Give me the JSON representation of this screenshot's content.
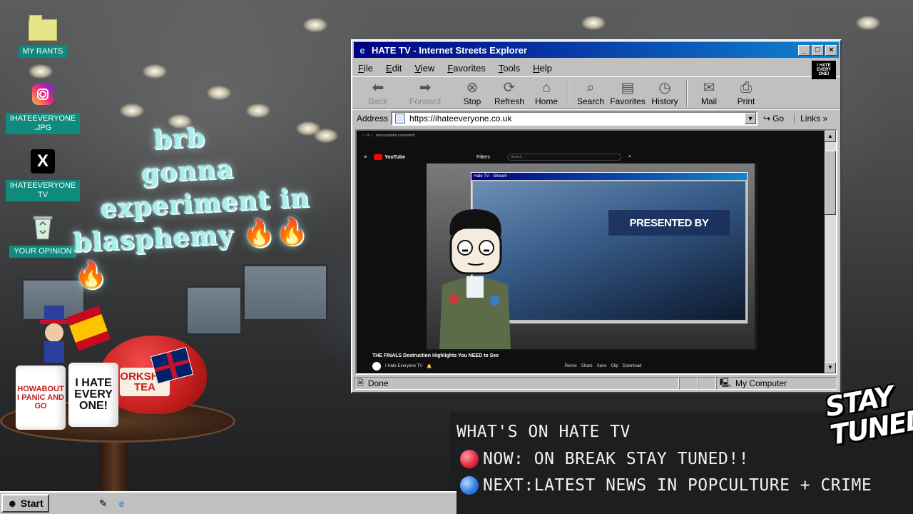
{
  "desktop": {
    "icons": [
      {
        "label": "MY RANTS",
        "icon": "folder-icon"
      },
      {
        "label": "IHATEEVERYONE\n.JPG",
        "icon": "instagram-icon"
      },
      {
        "label": "IHATEEVERYONE\nTV",
        "icon": "x-icon"
      },
      {
        "label": "YOUR OPINION",
        "icon": "recycle-bin-icon"
      }
    ],
    "brb_lines": [
      "brb",
      "gonna",
      "experiment in",
      "blasphemy 🔥🔥🔥"
    ]
  },
  "browser": {
    "title": "HATE TV - Internet Streets Explorer",
    "menu": [
      "File",
      "Edit",
      "View",
      "Favorites",
      "Tools",
      "Help"
    ],
    "brand_badge": "I HATE EVERY ONE!",
    "toolbar": [
      {
        "label": "Back",
        "icon": "back-arrow-icon",
        "enabled": false
      },
      {
        "label": "Forward",
        "icon": "forward-arrow-icon",
        "enabled": false
      },
      {
        "label": "Stop",
        "icon": "stop-icon",
        "enabled": true
      },
      {
        "label": "Refresh",
        "icon": "refresh-icon",
        "enabled": true
      },
      {
        "label": "Home",
        "icon": "home-icon",
        "enabled": true
      },
      {
        "label": "Search",
        "icon": "search-icon",
        "enabled": true
      },
      {
        "label": "Favorites",
        "icon": "favorites-icon",
        "enabled": true
      },
      {
        "label": "History",
        "icon": "history-icon",
        "enabled": true
      },
      {
        "label": "Mail",
        "icon": "mail-icon",
        "enabled": true
      },
      {
        "label": "Print",
        "icon": "print-icon",
        "enabled": true
      }
    ],
    "address_label": "Address",
    "address_value": "https://ihateeveryone.co.uk",
    "go_label": "Go",
    "links_label": "Links",
    "status_text": "Done",
    "zone_text": "My Computer"
  },
  "youtube": {
    "logo": "YouTube",
    "search_placeholder": "Search",
    "filters_label": "Filters",
    "stream_window_title": "Hate TV - Stream",
    "presented_by": "PRESENTED BY",
    "video_title": "THE FINALS Destruction Highlights You NEED to See",
    "channel_name": "I Hate Everyone TV",
    "actions": [
      "Remix",
      "Share",
      "Save",
      "Clip",
      "Download"
    ]
  },
  "ticker": {
    "heading": "WHAT'S ON HATE TV",
    "now": "NOW: ON BREAK STAY TUNED!!",
    "next": "NEXT:LATEST NEWS IN POPCULTURE + CRIME",
    "now_color": "#e0223c",
    "next_color": "#2b78e4"
  },
  "stay_tuned": [
    "STAY",
    "TUNED!"
  ],
  "taskbar": {
    "start_label": "Start"
  },
  "decor": {
    "teapot_label": "YORKSHIRE TEA",
    "mug_text": "I HATE EVERY ONE!",
    "mug2_text": "HOWABOUT I PANIC AND GO"
  }
}
